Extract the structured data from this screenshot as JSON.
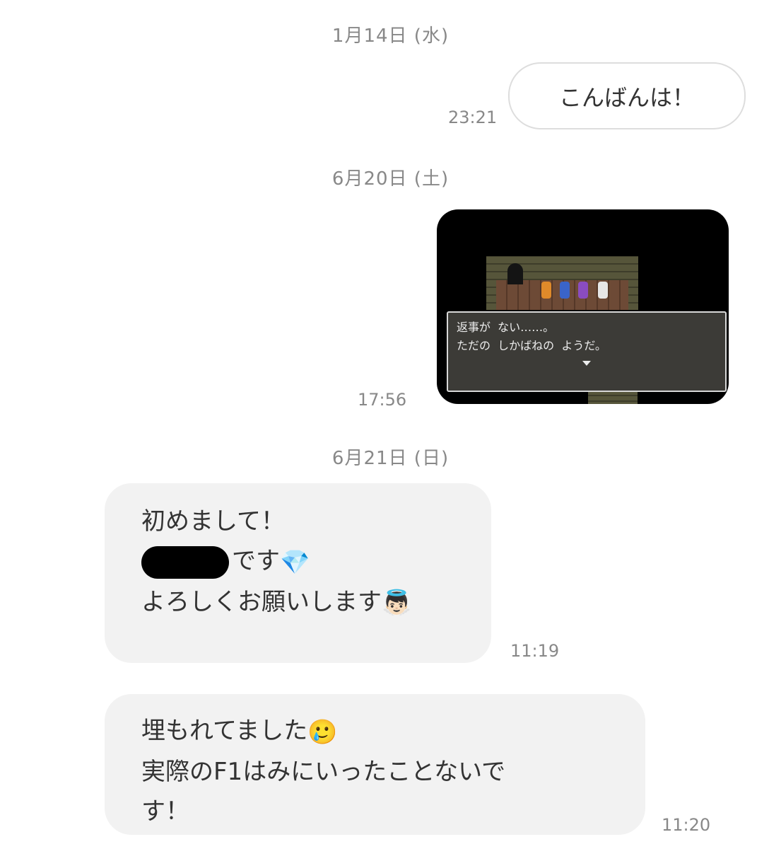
{
  "messages": [
    {
      "date": "1月14日 (水)",
      "outgoing_text": "こんばんは！",
      "time": "23:21"
    },
    {
      "date": "6月20日 (土)",
      "image": {
        "dialog_line1": "返事が  ない……。",
        "dialog_line2": "ただの  しかばねの  ようだ。"
      },
      "time": "17:56"
    },
    {
      "date": "6月21日 (日)",
      "incoming": {
        "line1": "初めまして！",
        "line2_text": "です",
        "line2_emoji": "💎",
        "line3_text": "よろしくお願いします",
        "line3_emoji": "👼🏻"
      },
      "time": "11:19"
    },
    {
      "incoming": {
        "line1_text": "埋もれてました",
        "line1_emoji": "🥲",
        "line2": "実際のF1はみにいったことないで",
        "line3": "す！"
      },
      "time": "11:20"
    }
  ],
  "colors": {
    "incoming_bubble": "#f2f2f2",
    "outgoing_border": "#dddddd",
    "meta_text": "#888888",
    "body_text": "#333333"
  }
}
